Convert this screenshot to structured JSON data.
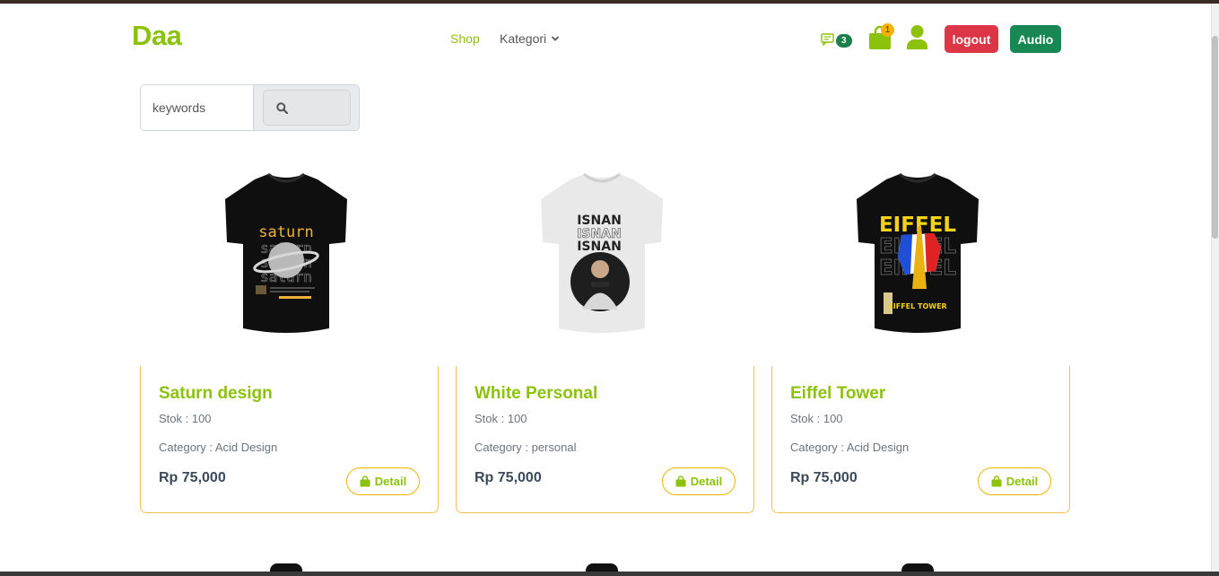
{
  "brand": "Daa",
  "nav": {
    "shop": "Shop",
    "kategori": "Kategori"
  },
  "header": {
    "chat_count": "3",
    "cart_count": "1",
    "logout_label": "logout",
    "audio_label": "Audio"
  },
  "search": {
    "placeholder": "keywords"
  },
  "products": [
    {
      "name": "Saturn design",
      "stock": "Stok : 100",
      "category": "Category : Acid Design",
      "price": "Rp 75,000",
      "detail_label": "Detail",
      "shirt_color": "#0f0f0f",
      "print_text": "saturn",
      "print_color": "#f0b23a"
    },
    {
      "name": "White Personal",
      "stock": "Stok : 100",
      "category": "Category : personal",
      "price": "Rp 75,000",
      "detail_label": "Detail",
      "shirt_color": "#e9e9e9",
      "print_text": "ISNAN",
      "print_color": "#222222"
    },
    {
      "name": "Eiffel Tower",
      "stock": "Stok : 100",
      "category": "Category : Acid Design",
      "price": "Rp 75,000",
      "detail_label": "Detail",
      "shirt_color": "#0f0f0f",
      "print_text": "EIFFEL",
      "print_color": "#f2d21a"
    }
  ],
  "colors": {
    "accent": "#8cc20b",
    "card_border": "#f0c24c",
    "logout": "#dc3545",
    "audio": "#198754"
  },
  "icons": {
    "chat": "chat-icon",
    "cart": "shopping-bag-icon",
    "user": "user-icon",
    "search": "search-icon",
    "detail": "shopping-bag-icon"
  }
}
